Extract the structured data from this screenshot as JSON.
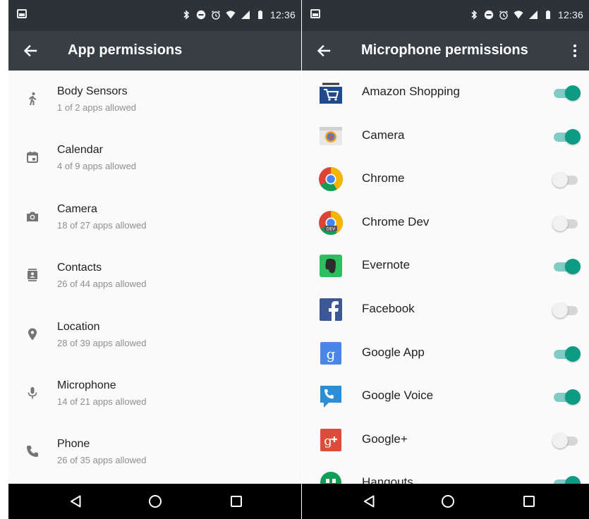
{
  "status_bar": {
    "time": "12:36"
  },
  "left_screen": {
    "title": "App permissions",
    "permissions": [
      {
        "label": "Body Sensors",
        "summary": "1 of 2 apps allowed",
        "icon": "body-sensors-icon"
      },
      {
        "label": "Calendar",
        "summary": "4 of 9 apps allowed",
        "icon": "calendar-icon"
      },
      {
        "label": "Camera",
        "summary": "18 of 27 apps allowed",
        "icon": "camera-icon"
      },
      {
        "label": "Contacts",
        "summary": "26 of 44 apps allowed",
        "icon": "contacts-icon"
      },
      {
        "label": "Location",
        "summary": "28 of 39 apps allowed",
        "icon": "location-icon"
      },
      {
        "label": "Microphone",
        "summary": "14 of 21 apps allowed",
        "icon": "microphone-icon"
      },
      {
        "label": "Phone",
        "summary": "26 of 35 apps allowed",
        "icon": "phone-icon"
      }
    ]
  },
  "right_screen": {
    "title": "Microphone permissions",
    "apps": [
      {
        "name": "Amazon Shopping",
        "enabled": true,
        "icon": "amazon-shopping-icon"
      },
      {
        "name": "Camera",
        "enabled": true,
        "icon": "camera-app-icon"
      },
      {
        "name": "Chrome",
        "enabled": false,
        "icon": "chrome-icon"
      },
      {
        "name": "Chrome Dev",
        "enabled": false,
        "icon": "chrome-dev-icon"
      },
      {
        "name": "Evernote",
        "enabled": true,
        "icon": "evernote-icon"
      },
      {
        "name": "Facebook",
        "enabled": false,
        "icon": "facebook-icon"
      },
      {
        "name": "Google App",
        "enabled": true,
        "icon": "google-app-icon"
      },
      {
        "name": "Google Voice",
        "enabled": true,
        "icon": "google-voice-icon"
      },
      {
        "name": "Google+",
        "enabled": false,
        "icon": "google-plus-icon"
      },
      {
        "name": "Hangouts",
        "enabled": true,
        "icon": "hangouts-icon"
      }
    ]
  },
  "colors": {
    "status_bar": "#2b3339",
    "toolbar": "#373f45",
    "toggle_on": "#0c9b85",
    "toggle_track_on": "#80cbc4"
  }
}
